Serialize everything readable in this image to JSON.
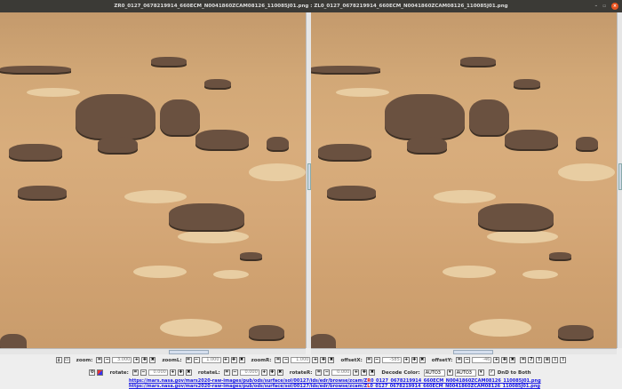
{
  "window": {
    "title": "ZR0_0127_0678219914_660ECM_N0041860ZCAM08126_110085J01.png : ZL0_0127_0678219914_660ECM_N0041860ZCAM08126_110085J01.png"
  },
  "toolbar": {
    "zoom_label": "zoom:",
    "zoom": "3.000",
    "zoomL_label": "zoomL:",
    "zoomL": "1.000",
    "zoomR_label": "zoomR:",
    "zoomR": "1.000",
    "offsetX_label": "offsetX:",
    "offsetX": "-585",
    "offsetY_label": "offsetY:",
    "offsetY": "-46",
    "rotate_label": "rotate:",
    "rotate": "0.000",
    "rotateL_label": "rotateL:",
    "rotateL": "0.000",
    "rotateR_label": "rotateR:",
    "rotateR": "0.000",
    "decode_label": "Decode Color:",
    "decodeL": "AUTO3",
    "decodeR": "AUTO3",
    "dnd_label": "DnD to Both",
    "dnd_checked": true
  },
  "urls": {
    "base": "https://mars.nasa.gov/mars2020-raw-images/pub/ods/surface/sol/00127/ids/edr/browse/zcam/",
    "right_prefix": "Z",
    "right_hl": "R",
    "right_rest": "0_0127_0678219914_660ECM_N0041860ZCAM08126_110085J01.png",
    "left_prefix": "Z",
    "left_hl": "L",
    "left_rest": "0_0127_0678219914_660ECM_N0041860ZCAM08126_110085J01.png"
  }
}
